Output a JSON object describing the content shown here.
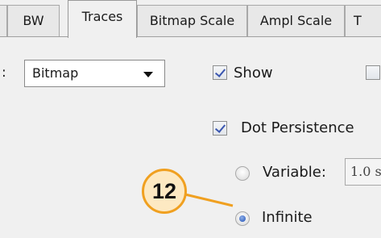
{
  "tabs": [
    {
      "label": "BW"
    },
    {
      "label": "Traces",
      "active": true
    },
    {
      "label": "Bitmap Scale"
    },
    {
      "label": "Ampl Scale"
    },
    {
      "label": "T"
    }
  ],
  "form": {
    "label_suffix": ":",
    "trace_type_value": "Bitmap",
    "show_label": "Show",
    "show_checked": true,
    "extra_checkbox_checked": false,
    "dot_persistence_label": "Dot Persistence",
    "dot_persistence_checked": true,
    "variable_label": "Variable:",
    "variable_selected": false,
    "variable_value": "1.0 s",
    "infinite_label": "Infinite",
    "infinite_selected": true
  },
  "callout": {
    "number": "12",
    "color": "#f0a020",
    "fill": "#fde9c2"
  },
  "colors": {
    "check": "#3a56b0",
    "radio_dot": "#1f4fb5",
    "background": "#f0f0f0"
  }
}
